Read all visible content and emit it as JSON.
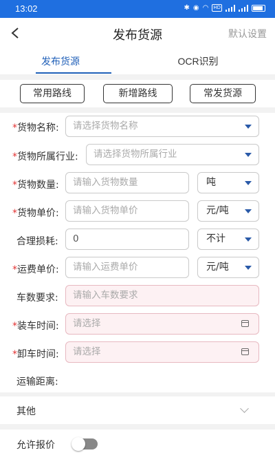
{
  "status_bar": {
    "time": "13:02",
    "hd_label": "HD"
  },
  "nav": {
    "title": "发布货源",
    "right_label": "默认设置"
  },
  "tabs": [
    {
      "label": "发布货源"
    },
    {
      "label": "OCR识别"
    }
  ],
  "quick_buttons": [
    {
      "label": "常用路线"
    },
    {
      "label": "新增路线"
    },
    {
      "label": "常发货源"
    }
  ],
  "form": {
    "cargo_name": {
      "label": "货物名称:",
      "placeholder": "请选择货物名称"
    },
    "industry": {
      "label": "货物所属行业:",
      "placeholder": "请选择货物所属行业"
    },
    "quantity": {
      "label": "货物数量:",
      "placeholder": "请输入货物数量",
      "unit": "吨"
    },
    "unit_price": {
      "label": "货物单价:",
      "placeholder": "请输入货物单价",
      "unit": "元/吨"
    },
    "loss": {
      "label": "合理损耗:",
      "value": "0",
      "unit": "不计"
    },
    "freight_price": {
      "label": "运费单价:",
      "placeholder": "请输入运费单价",
      "unit": "元/吨"
    },
    "vehicle_count": {
      "label": "车数要求:",
      "placeholder": "请输入车数要求"
    },
    "load_time": {
      "label": "装车时间:",
      "placeholder": "请选择"
    },
    "unload_time": {
      "label": "卸车时间:",
      "placeholder": "请选择"
    },
    "distance": {
      "label": "运输距离:"
    }
  },
  "other": {
    "label": "其他"
  },
  "allow_bid": {
    "label": "允许报价",
    "enabled": false
  },
  "required_mark": "*"
}
